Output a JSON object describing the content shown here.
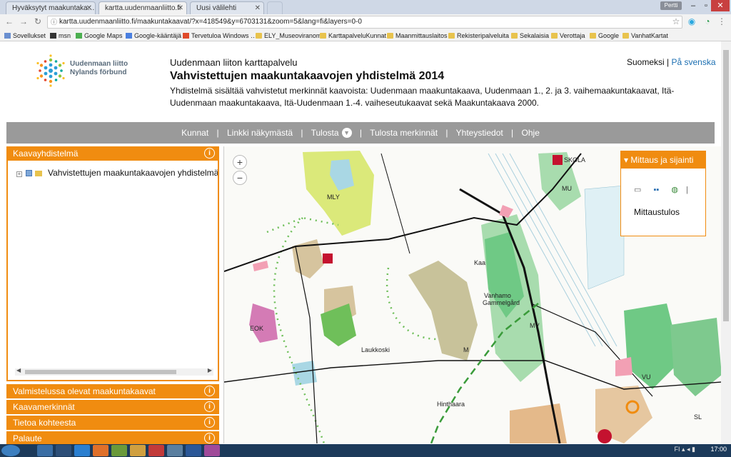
{
  "browser": {
    "tabs": [
      {
        "title": "Hyväksytyt maakuntaka…"
      },
      {
        "title": "kartta.uudenmaanliitto.fi"
      },
      {
        "title": "Uusi välilehti"
      }
    ],
    "url": "kartta.uudenmaanliitto.fi/maakuntakaavat/?x=418549&y=6703131&zoom=5&lang=fi&layers=0-0",
    "user_badge": "Pertti",
    "bookmarks": [
      {
        "label": "Sovellukset"
      },
      {
        "label": "msn"
      },
      {
        "label": "Google Maps"
      },
      {
        "label": "Google-kääntäjä"
      },
      {
        "label": "Tervetuloa Windows …"
      },
      {
        "label": "ELY_Museoviranom"
      },
      {
        "label": "KarttapalveluKunnat"
      },
      {
        "label": "Maanmittauslaitos"
      },
      {
        "label": "Rekisteripalveluita"
      },
      {
        "label": "Sekalaisia"
      },
      {
        "label": "Verottaja"
      },
      {
        "label": "Google"
      },
      {
        "label": "VanhatKartat"
      }
    ]
  },
  "header": {
    "logo_line1": "Uudenmaan liitto",
    "logo_line2": "Nylands förbund",
    "site_name": "Uudenmaan liiton karttapalvelu",
    "title": "Vahvistettujen maakuntakaavojen yhdistelmä 2014",
    "description": "Yhdistelmä sisältää vahvistetut merkinnät kaavoista: Uudenmaan maakuntakaava, Uudenmaan 1., 2. ja 3. vaihemaakuntakaavat, Itä-Uudenmaan maakuntakaava, Itä-Uudenmaan 1.-4. vaiheseutukaavat sekä Maakuntakaava 2000.",
    "lang_current": "Suomeksi",
    "lang_separator": "|",
    "lang_other": "På svenska"
  },
  "navbar": {
    "separator": "|",
    "items": [
      "Kunnat",
      "Linkki näkymästä",
      "Tulosta",
      "Tulosta merkinnät",
      "Yhteystiedot",
      "Ohje"
    ]
  },
  "left_panel": {
    "info_icon_text": "i",
    "active_section": "Kaavayhdistelmä",
    "tree_item": "Vahvistettujen maakuntakaavojen yhdistelmä",
    "sections": [
      "Valmistelussa olevat maakuntakaavat",
      "Kaavamerkinnät",
      "Tietoa kohteesta",
      "Palaute"
    ]
  },
  "map": {
    "zoom_in": "+",
    "zoom_out": "−",
    "measure_title": "Mittaus ja sijainti",
    "measure_result": "Mittaustulos",
    "labels": [
      "MLY",
      "M",
      "MU",
      "MV",
      "VU",
      "EOK",
      "SL",
      "Laukkoski",
      "Hinthaara",
      "SKOLA",
      "Kaa",
      "Vanhamo",
      "Gammelgård"
    ]
  },
  "taskbar": {
    "time": "17:00",
    "lang": "FI"
  },
  "colors": {
    "accent": "#f08c10",
    "navbar": "#9a9a9a",
    "link": "#1c6fb2"
  }
}
